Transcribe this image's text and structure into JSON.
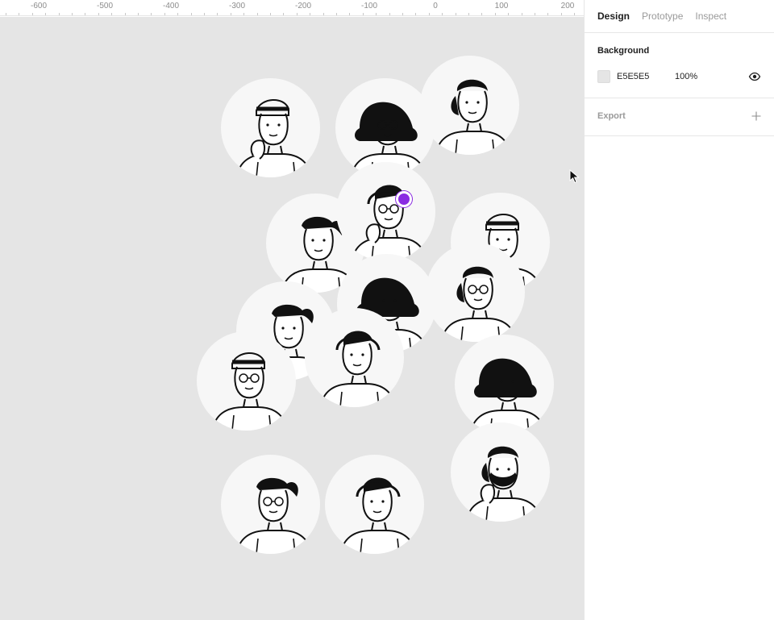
{
  "ruler": {
    "ticks": [
      "-600",
      "-500",
      "-400",
      "-300",
      "-200",
      "-100",
      "0",
      "100",
      "200"
    ]
  },
  "canvas": {
    "background_color": "#e5e5e5",
    "avatars": [
      {
        "name": "avatar-man-headband-chin-rest"
      },
      {
        "name": "avatar-woman-glasses-leaning"
      },
      {
        "name": "avatar-woman-headset"
      },
      {
        "name": "avatar-woman-ponytail"
      },
      {
        "name": "avatar-man-headphones-chin-rest"
      },
      {
        "name": "avatar-woman-side-hair"
      },
      {
        "name": "avatar-man-back-view"
      },
      {
        "name": "avatar-woman-holding-box"
      },
      {
        "name": "avatar-man-round-glasses"
      },
      {
        "name": "avatar-woman-ponytail-shrug"
      },
      {
        "name": "avatar-man-overalls"
      },
      {
        "name": "avatar-man-beanie-chin-rest"
      },
      {
        "name": "avatar-man-beard"
      },
      {
        "name": "avatar-man-laptop"
      },
      {
        "name": "avatar-man-waving-backpack"
      }
    ],
    "selection_color": "#8a2be2"
  },
  "panel": {
    "tabs": [
      {
        "label": "Design",
        "active": true
      },
      {
        "label": "Prototype",
        "active": false
      },
      {
        "label": "Inspect",
        "active": false
      }
    ],
    "background": {
      "title": "Background",
      "hex": "E5E5E5",
      "opacity": "100%",
      "visibility_icon": "eye-icon"
    },
    "export": {
      "title": "Export",
      "add_icon": "plus-icon"
    }
  }
}
